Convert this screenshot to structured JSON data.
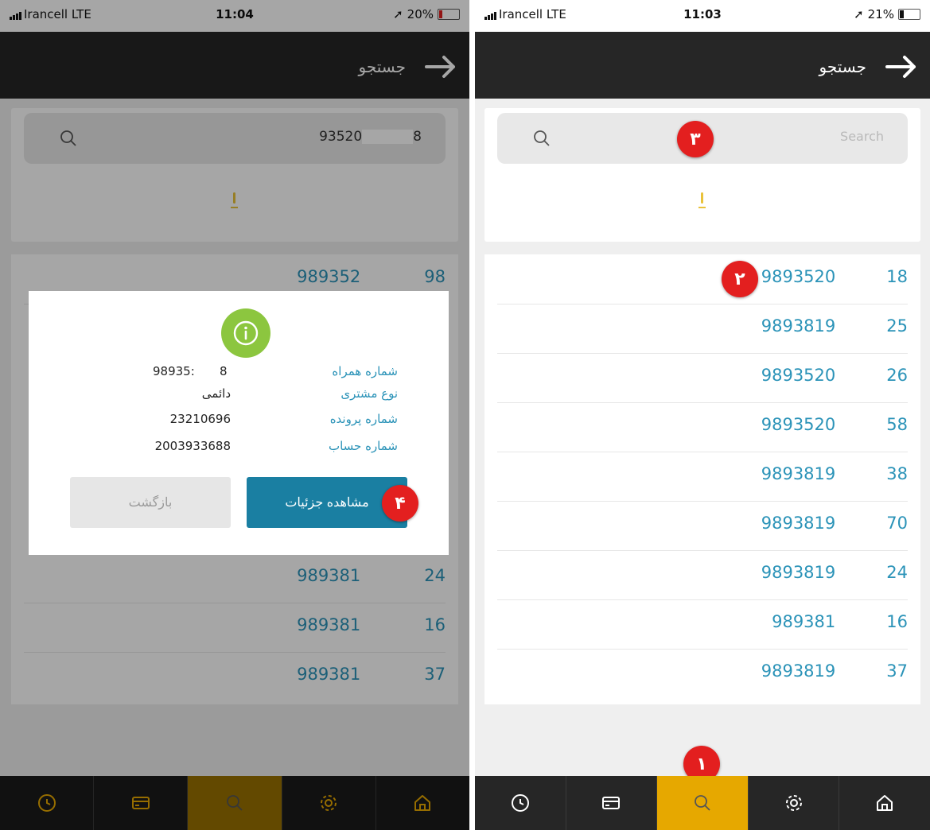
{
  "left": {
    "status": {
      "carrier": "Irancell  LTE",
      "time": "11:04",
      "battery": "20%",
      "battery_level": 0.2
    },
    "header": {
      "title": "جستجو"
    },
    "search": {
      "value_a": "93520",
      "value_b": "8"
    },
    "list": [
      {
        "a": "989352",
        "b": "98"
      },
      {
        "a": "989381",
        "b": "24"
      },
      {
        "a": "989381",
        "b": "16"
      },
      {
        "a": "989381",
        "b": "37"
      }
    ],
    "dialog": {
      "labels": [
        "شماره همراه",
        "نوع مشتری",
        "شماره پرونده",
        "شماره حساب"
      ],
      "values": [
        "98935:",
        "8",
        "دائمی",
        "23210696",
        "2003933688"
      ],
      "details_button": "مشاهده جزئیات",
      "back_button": "بازگشت",
      "marker": "۴"
    }
  },
  "right": {
    "status": {
      "carrier": "Irancell  LTE",
      "time": "11:03",
      "battery": "21%",
      "battery_level": 0.21
    },
    "header": {
      "title": "جستجو"
    },
    "search": {
      "placeholder": "Search",
      "marker": "۳"
    },
    "list": [
      {
        "a": "9893520",
        "b": "18"
      },
      {
        "a": "9893819",
        "b": "25"
      },
      {
        "a": "9893520",
        "b": "26"
      },
      {
        "a": "9893520",
        "b": "58"
      },
      {
        "a": "9893819",
        "b": "38"
      },
      {
        "a": "9893819",
        "b": "70"
      },
      {
        "a": "9893819",
        "b": "24"
      },
      {
        "a": "989381",
        "b": "16"
      },
      {
        "a": "9893819",
        "b": "37"
      }
    ],
    "list_marker": "۲",
    "nav_marker": "۱"
  },
  "nav": {
    "items": [
      "clock-icon",
      "card-icon",
      "search-icon",
      "gear-icon",
      "home-icon"
    ],
    "active_index": 2,
    "colors": {
      "bar": "#262626",
      "active": "#e6a800"
    }
  },
  "colors": {
    "accent": "#2b93b8",
    "marker": "#e31f1f",
    "info": "#8cc63f",
    "primary_button": "#1a7fa2"
  }
}
